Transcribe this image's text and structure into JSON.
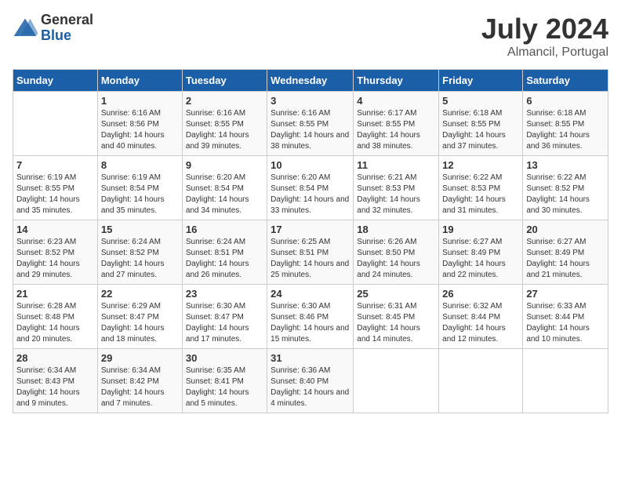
{
  "header": {
    "logo_general": "General",
    "logo_blue": "Blue",
    "month_year": "July 2024",
    "location": "Almancil, Portugal"
  },
  "calendar": {
    "days_of_week": [
      "Sunday",
      "Monday",
      "Tuesday",
      "Wednesday",
      "Thursday",
      "Friday",
      "Saturday"
    ],
    "weeks": [
      [
        {
          "day": "",
          "sunrise": "",
          "sunset": "",
          "daylight": ""
        },
        {
          "day": "1",
          "sunrise": "Sunrise: 6:16 AM",
          "sunset": "Sunset: 8:56 PM",
          "daylight": "Daylight: 14 hours and 40 minutes."
        },
        {
          "day": "2",
          "sunrise": "Sunrise: 6:16 AM",
          "sunset": "Sunset: 8:55 PM",
          "daylight": "Daylight: 14 hours and 39 minutes."
        },
        {
          "day": "3",
          "sunrise": "Sunrise: 6:16 AM",
          "sunset": "Sunset: 8:55 PM",
          "daylight": "Daylight: 14 hours and 38 minutes."
        },
        {
          "day": "4",
          "sunrise": "Sunrise: 6:17 AM",
          "sunset": "Sunset: 8:55 PM",
          "daylight": "Daylight: 14 hours and 38 minutes."
        },
        {
          "day": "5",
          "sunrise": "Sunrise: 6:18 AM",
          "sunset": "Sunset: 8:55 PM",
          "daylight": "Daylight: 14 hours and 37 minutes."
        },
        {
          "day": "6",
          "sunrise": "Sunrise: 6:18 AM",
          "sunset": "Sunset: 8:55 PM",
          "daylight": "Daylight: 14 hours and 36 minutes."
        }
      ],
      [
        {
          "day": "7",
          "sunrise": "Sunrise: 6:19 AM",
          "sunset": "Sunset: 8:55 PM",
          "daylight": "Daylight: 14 hours and 35 minutes."
        },
        {
          "day": "8",
          "sunrise": "Sunrise: 6:19 AM",
          "sunset": "Sunset: 8:54 PM",
          "daylight": "Daylight: 14 hours and 35 minutes."
        },
        {
          "day": "9",
          "sunrise": "Sunrise: 6:20 AM",
          "sunset": "Sunset: 8:54 PM",
          "daylight": "Daylight: 14 hours and 34 minutes."
        },
        {
          "day": "10",
          "sunrise": "Sunrise: 6:20 AM",
          "sunset": "Sunset: 8:54 PM",
          "daylight": "Daylight: 14 hours and 33 minutes."
        },
        {
          "day": "11",
          "sunrise": "Sunrise: 6:21 AM",
          "sunset": "Sunset: 8:53 PM",
          "daylight": "Daylight: 14 hours and 32 minutes."
        },
        {
          "day": "12",
          "sunrise": "Sunrise: 6:22 AM",
          "sunset": "Sunset: 8:53 PM",
          "daylight": "Daylight: 14 hours and 31 minutes."
        },
        {
          "day": "13",
          "sunrise": "Sunrise: 6:22 AM",
          "sunset": "Sunset: 8:52 PM",
          "daylight": "Daylight: 14 hours and 30 minutes."
        }
      ],
      [
        {
          "day": "14",
          "sunrise": "Sunrise: 6:23 AM",
          "sunset": "Sunset: 8:52 PM",
          "daylight": "Daylight: 14 hours and 29 minutes."
        },
        {
          "day": "15",
          "sunrise": "Sunrise: 6:24 AM",
          "sunset": "Sunset: 8:52 PM",
          "daylight": "Daylight: 14 hours and 27 minutes."
        },
        {
          "day": "16",
          "sunrise": "Sunrise: 6:24 AM",
          "sunset": "Sunset: 8:51 PM",
          "daylight": "Daylight: 14 hours and 26 minutes."
        },
        {
          "day": "17",
          "sunrise": "Sunrise: 6:25 AM",
          "sunset": "Sunset: 8:51 PM",
          "daylight": "Daylight: 14 hours and 25 minutes."
        },
        {
          "day": "18",
          "sunrise": "Sunrise: 6:26 AM",
          "sunset": "Sunset: 8:50 PM",
          "daylight": "Daylight: 14 hours and 24 minutes."
        },
        {
          "day": "19",
          "sunrise": "Sunrise: 6:27 AM",
          "sunset": "Sunset: 8:49 PM",
          "daylight": "Daylight: 14 hours and 22 minutes."
        },
        {
          "day": "20",
          "sunrise": "Sunrise: 6:27 AM",
          "sunset": "Sunset: 8:49 PM",
          "daylight": "Daylight: 14 hours and 21 minutes."
        }
      ],
      [
        {
          "day": "21",
          "sunrise": "Sunrise: 6:28 AM",
          "sunset": "Sunset: 8:48 PM",
          "daylight": "Daylight: 14 hours and 20 minutes."
        },
        {
          "day": "22",
          "sunrise": "Sunrise: 6:29 AM",
          "sunset": "Sunset: 8:47 PM",
          "daylight": "Daylight: 14 hours and 18 minutes."
        },
        {
          "day": "23",
          "sunrise": "Sunrise: 6:30 AM",
          "sunset": "Sunset: 8:47 PM",
          "daylight": "Daylight: 14 hours and 17 minutes."
        },
        {
          "day": "24",
          "sunrise": "Sunrise: 6:30 AM",
          "sunset": "Sunset: 8:46 PM",
          "daylight": "Daylight: 14 hours and 15 minutes."
        },
        {
          "day": "25",
          "sunrise": "Sunrise: 6:31 AM",
          "sunset": "Sunset: 8:45 PM",
          "daylight": "Daylight: 14 hours and 14 minutes."
        },
        {
          "day": "26",
          "sunrise": "Sunrise: 6:32 AM",
          "sunset": "Sunset: 8:44 PM",
          "daylight": "Daylight: 14 hours and 12 minutes."
        },
        {
          "day": "27",
          "sunrise": "Sunrise: 6:33 AM",
          "sunset": "Sunset: 8:44 PM",
          "daylight": "Daylight: 14 hours and 10 minutes."
        }
      ],
      [
        {
          "day": "28",
          "sunrise": "Sunrise: 6:34 AM",
          "sunset": "Sunset: 8:43 PM",
          "daylight": "Daylight: 14 hours and 9 minutes."
        },
        {
          "day": "29",
          "sunrise": "Sunrise: 6:34 AM",
          "sunset": "Sunset: 8:42 PM",
          "daylight": "Daylight: 14 hours and 7 minutes."
        },
        {
          "day": "30",
          "sunrise": "Sunrise: 6:35 AM",
          "sunset": "Sunset: 8:41 PM",
          "daylight": "Daylight: 14 hours and 5 minutes."
        },
        {
          "day": "31",
          "sunrise": "Sunrise: 6:36 AM",
          "sunset": "Sunset: 8:40 PM",
          "daylight": "Daylight: 14 hours and 4 minutes."
        },
        {
          "day": "",
          "sunrise": "",
          "sunset": "",
          "daylight": ""
        },
        {
          "day": "",
          "sunrise": "",
          "sunset": "",
          "daylight": ""
        },
        {
          "day": "",
          "sunrise": "",
          "sunset": "",
          "daylight": ""
        }
      ]
    ]
  }
}
